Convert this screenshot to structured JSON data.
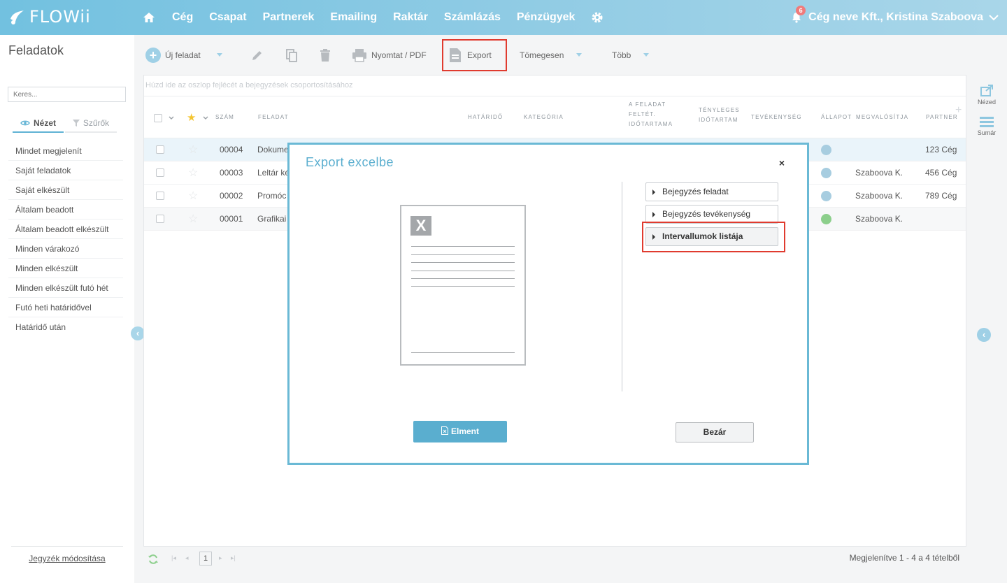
{
  "brand": {
    "name": "FLOWii"
  },
  "nav": {
    "home_icon": "home-icon",
    "items": [
      "Cég",
      "Csapat",
      "Partnerek",
      "Emailing",
      "Raktár",
      "Számlázás",
      "Pénzügyek"
    ],
    "settings_icon": "gear-icon"
  },
  "user": {
    "notifications": "6",
    "name": "Cég neve Kft., Kristina Szaboova"
  },
  "sidebar": {
    "title": "Feladatok",
    "search_placeholder": "Keres...",
    "tabs": [
      "Nézet",
      "Szűrők"
    ],
    "items": [
      "Mindet megjelenít",
      "Saját feladatok",
      "Saját elkészült",
      "Általam beadott",
      "Általam beadott elkészült",
      "Minden várakozó",
      "Minden elkészült",
      "Minden elkészült futó hét",
      "Futó heti határidővel",
      "Határidő után"
    ],
    "footer_link": "Jegyzék módosítása"
  },
  "toolbar": {
    "new_task": "Új feladat",
    "print": "Nyomtat / PDF",
    "export": "Export",
    "bulk": "Tömegesen",
    "more": "Több"
  },
  "right_rail": {
    "view": "Nézed",
    "summary": "Sumár"
  },
  "grid": {
    "group_hint": "Húzd ide az oszlop fejlécét a bejegyzések csoportosításához",
    "headers": {
      "number": "Szám",
      "task": "Feladat",
      "deadline": "Határidő",
      "category": "Kategória",
      "planned_l1": "A feladat",
      "planned_l2": "feltét.",
      "planned_l3": "időtartama",
      "actual_l1": "Tényleges",
      "actual_l2": "időtartam",
      "activity": "Tevékenység",
      "status": "Állapot",
      "assignee": "Megvalósítja",
      "partner": "Partner"
    },
    "rows": [
      {
        "number": "00004",
        "task": "Dokume",
        "assignee": "",
        "partner": "123 Cég",
        "status": "open"
      },
      {
        "number": "00003",
        "task": "Leltár ké",
        "assignee": "Szaboova K.",
        "partner": "456 Cég",
        "status": "open"
      },
      {
        "number": "00002",
        "task": "Promóc",
        "assignee": "Szaboova K.",
        "partner": "789 Cég",
        "status": "open"
      },
      {
        "number": "00001",
        "task": "Grafikai",
        "assignee": "Szaboova K.",
        "partner": "",
        "status": "done"
      }
    ],
    "pager": {
      "page": "1",
      "summary": "Megjelenítve 1 - 4 a 4 tételből"
    }
  },
  "modal": {
    "title": "Export excelbe",
    "close": "×",
    "options": [
      "Bejegyzés feladat",
      "Bejegyzés tevékenység",
      "Intervallumok listája"
    ],
    "save": "Elment",
    "close_button": "Bezár",
    "doc_mark": "X"
  },
  "colors": {
    "accent": "#5aaecf",
    "highlight": "#e03b2f",
    "status_done": "#8ccf8c"
  }
}
